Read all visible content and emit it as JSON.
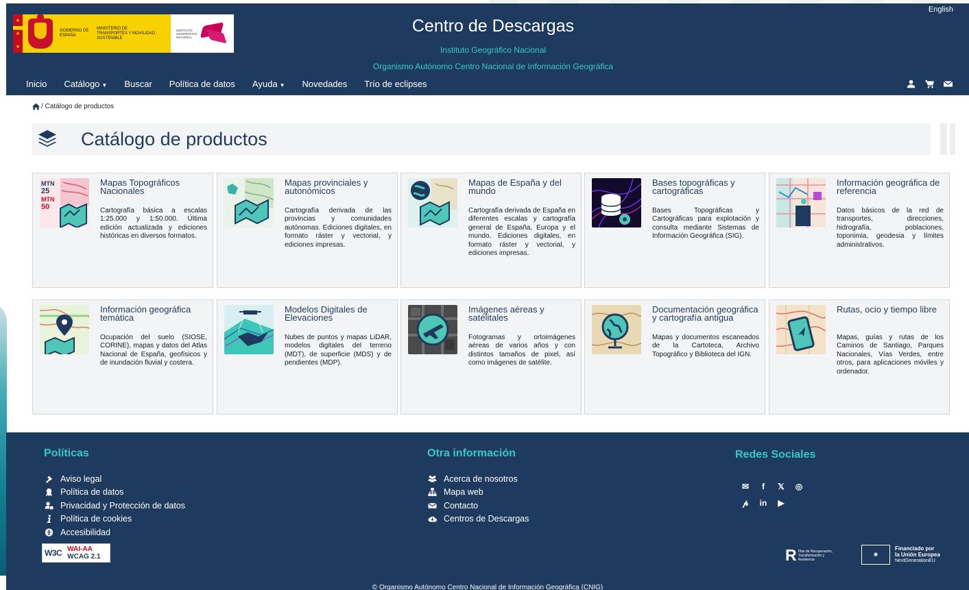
{
  "header": {
    "language_link": "English",
    "title": "Centro de Descargas",
    "subtitle1": "Instituto Geográfico Nacional",
    "subtitle2": "Organismo Autónomo Centro Nacional de Información Geográfica",
    "logos": {
      "gobierno": "GOBIERNO DE ESPAÑA",
      "ministerio": "MINISTERIO DE TRANSPORTES Y MOVILIDAD SOSTENIBLE",
      "ign": "INSTITUTO GEOGRÁFICO NACIONAL",
      "cnig": "cnig"
    },
    "nav": [
      "Inicio",
      "Catálogo",
      "Buscar",
      "Política de datos",
      "Ayuda",
      "Novedades",
      "Trío de eclipses"
    ],
    "nav_icons": [
      "user-icon",
      "cart-icon",
      "envelope-icon"
    ]
  },
  "breadcrumb": {
    "current": "/ Catálogo de productos"
  },
  "page": {
    "title": "Catálogo de productos"
  },
  "cards": [
    {
      "title": "Mapas Topográficos Nacionales",
      "desc": "Cartografía básica a escalas 1:25.000 y 1:50.000. Última edición actualizada y ediciones históricas en diversos formatos.",
      "thumb_labels": [
        "MTN 25",
        "MTN 50"
      ]
    },
    {
      "title": "Mapas provinciales y autonómicos",
      "desc": "Cartografía derivada de las provincias y comunidades autónomas. Ediciones digitales, en formato ráster y vectorial, y ediciones impresas."
    },
    {
      "title": "Mapas de España y del mundo",
      "desc": "Cartografía derivada de España en diferentes escalas y cartografía general de España, Europa y el mundo. Ediciones digitales, en formato ráster y vectorial, y ediciones impresas."
    },
    {
      "title": "Bases topográficas y cartográficas",
      "desc": "Bases Topográficas y Cartográficas para explotación y consulta mediante Sistemas de Información Geográfica (SIG)."
    },
    {
      "title": "Información geográfica de referencia",
      "desc": "Datos básicos de la red de transportes, direcciones, hidrografía, poblaciones, toponimia, geodesia y límites administrativos."
    },
    {
      "title": "Información geográfica temática",
      "desc": "Ocupación del suelo (SIOSE, CORINE), mapas y datos del Atlas Nacional de España, geofísicos y de inundación fluvial y costera."
    },
    {
      "title": "Modelos Digitales de Elevaciones",
      "desc": "Nubes de puntos y mapas LiDAR, modelos digitales del terreno (MDT), de superficie (MDS) y de pendientes (MDP)."
    },
    {
      "title": "Imágenes aéreas y satélitales",
      "desc": "Fotogramas y ortoimágenes aéreas de varios años y con distintos tamaños de pixel, así como imágenes de satélite."
    },
    {
      "title": "Documentación geográfica y cartografía antigua",
      "desc": "Mapas y documentos escaneados de la Cartoteca, Archivo Topográfico y Biblioteca del IGN."
    },
    {
      "title": "Rutas, ocio y tiempo libre",
      "desc": "Mapas, guías y rutas de los Caminos de Santiago, Parques Nacionales, Vías Verdes, entre otros, para aplicaciones móviles y ordenador."
    }
  ],
  "footer": {
    "politicas_title": "Políticas",
    "politicas": [
      "Aviso legal",
      "Política de datos",
      "Privacidad y Protección de datos",
      "Política de cookies",
      "Accesibilidad"
    ],
    "otra_title": "Otra información",
    "otra": [
      "Acerca de nosotros",
      "Mapa web",
      "Contacto",
      "Centros de Descargas"
    ],
    "redes_title": "Redes Sociales",
    "social": [
      "✉",
      "f",
      "𝕏",
      "◎",
      "𝓅",
      "in",
      "▶"
    ],
    "w3c": {
      "logo": "W3C",
      "level": "WAI-AA",
      "wcag": "WCAG 2.1"
    },
    "prtr": {
      "mark": "R",
      "text": "Plan de Recuperación, Transformación y Resiliencia"
    },
    "eu": {
      "line1": "Financiado por",
      "line2": "la Unión Europea",
      "line3": "NextGenerationEU"
    },
    "copyright": "© Organismo Autónomo Centro Nacional de Información Geográfica (CNIG)"
  }
}
